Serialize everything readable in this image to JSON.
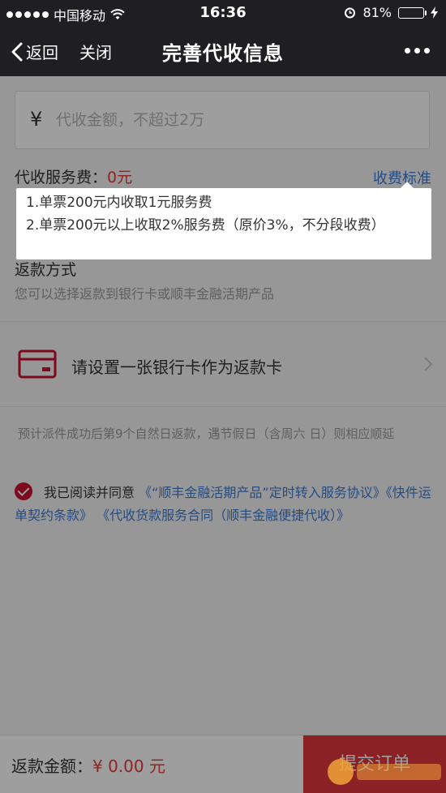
{
  "status_bar": {
    "carrier": "中国移动",
    "time": "16:36",
    "battery": "81%"
  },
  "nav": {
    "back_label": "返回",
    "close_label": "关闭",
    "title": "完善代收信息"
  },
  "amount_input": {
    "currency_symbol": "¥",
    "placeholder": "代收金额，不超过2万",
    "value": ""
  },
  "service_fee": {
    "label": "代收服务费：",
    "value": "0元",
    "standard_link": "收费标准"
  },
  "tooltip": {
    "line1": "1.单票200元内收取1元服务费",
    "line2": "2.单票200元以上收取2%服务费（原价3%，不分段收费）"
  },
  "refund_method": {
    "title": "返款方式",
    "subtitle": "您可以选择返款到银行卡或顺丰金融活期产品"
  },
  "bank_card": {
    "label": "请设置一张银行卡作为返款卡"
  },
  "notice": "预计派件成功后第9个自然日返款，遇节假日（含周六 日）则相应顺延",
  "agreement": {
    "prefix": "我已阅读并同意",
    "link1": "《“顺丰金融活期产品”定时转入服务协议》",
    "link2": "《快件运单契约条款》",
    "link3": "《代收货款服务合同（顺丰金融便捷代收）》"
  },
  "bottom_bar": {
    "refund_label": "返款金额：",
    "refund_value": "¥ 0.00 元",
    "submit_label": "提交订单"
  },
  "colors": {
    "accent_red": "#e0353d",
    "link_blue": "#3a7bd5",
    "nav_bg": "#1f1f22"
  }
}
